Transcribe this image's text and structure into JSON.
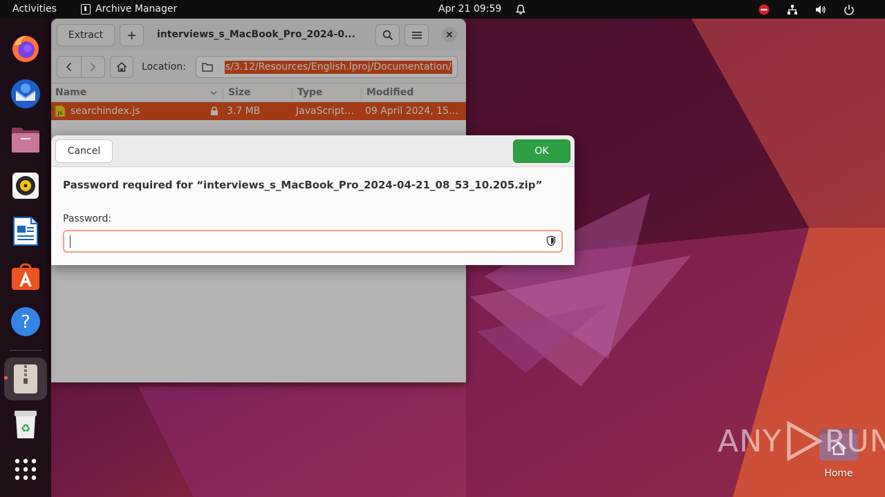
{
  "topbar": {
    "activities": "Activities",
    "app_name": "Archive Manager",
    "date": "Apr 21",
    "time": "09:59"
  },
  "dock": {
    "items": [
      {
        "name": "firefox"
      },
      {
        "name": "thunderbird"
      },
      {
        "name": "files"
      },
      {
        "name": "rhythmbox"
      },
      {
        "name": "libreoffice-writer"
      },
      {
        "name": "ubuntu-software"
      },
      {
        "name": "help"
      },
      {
        "name": "archive-manager",
        "active": true
      },
      {
        "name": "trash"
      },
      {
        "name": "show-applications"
      }
    ]
  },
  "archive_window": {
    "extract_label": "Extract",
    "add_label": "+",
    "title": "interviews_s_MacBook_Pro_2024-0...",
    "location_label": "Location:",
    "location_path": "s/3.12/Resources/English.lproj/Documentation/",
    "columns": {
      "name": "Name",
      "size": "Size",
      "type": "Type",
      "modified": "Modified"
    },
    "files": [
      {
        "name": "searchindex.js",
        "size": "3.7 MB",
        "type": "JavaScript…",
        "modified": "09 April 2024, 15…"
      }
    ]
  },
  "dialog": {
    "cancel_label": "Cancel",
    "ok_label": "OK",
    "message": "Password required for “interviews_s_MacBook_Pro_2024-04-21_08_53_10.205.zip”",
    "password_label": "Password:",
    "password_value": ""
  },
  "desktop": {
    "home_label": "Home",
    "watermark_a": "ANY",
    "watermark_b": "RUN"
  },
  "colors": {
    "accent": "#e95420",
    "ok_button": "#2ea043",
    "topbar": "#0e0e0e"
  }
}
